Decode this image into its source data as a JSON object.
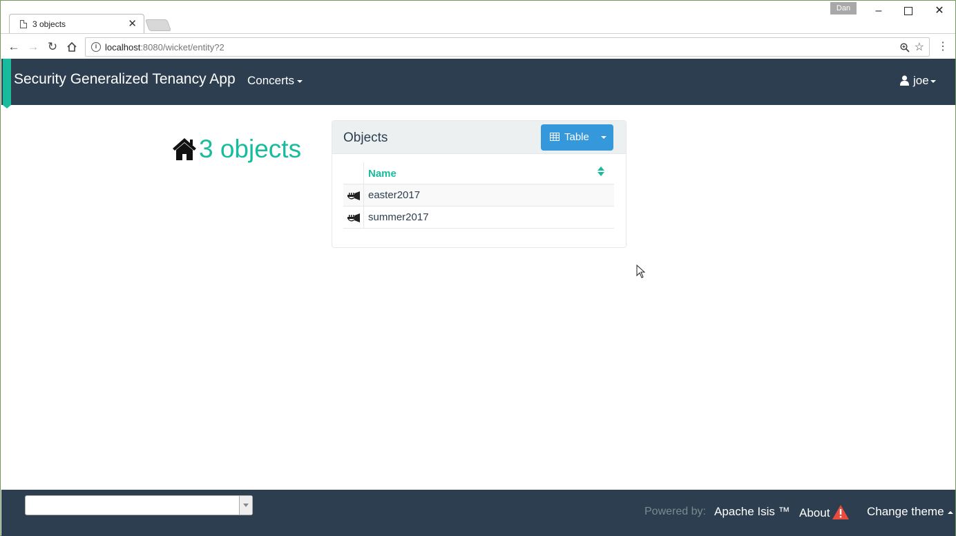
{
  "browser": {
    "tab_title": "3 objects",
    "profile_name": "Dan",
    "url_host": "localhost",
    "url_rest": ":8080/wicket/entity?2",
    "window_controls": [
      "minimize-icon",
      "maximize-icon",
      "close-icon"
    ]
  },
  "navbar": {
    "brand": "Security Generalized Tenancy App",
    "menu_concerts": "Concerts",
    "user_name": "joe",
    "colors": {
      "background": "#2c3e50",
      "accent": "#18bc9c"
    }
  },
  "main": {
    "heading": "3 objects",
    "heading_icon": "home-icon",
    "panel": {
      "title": "Objects",
      "view_button_label": "Table",
      "view_button_icon": "table-icon",
      "columns": [
        "Name"
      ],
      "rows": [
        {
          "icon": "trumpet-icon",
          "name": "easter2017"
        },
        {
          "icon": "trumpet-icon",
          "name": "summer2017"
        }
      ]
    }
  },
  "footer": {
    "theme_select_value": "",
    "powered_by_label": "Powered by:",
    "powered_by_link": "Apache Isis ™",
    "about_label": "About",
    "change_theme_label": "Change theme"
  }
}
